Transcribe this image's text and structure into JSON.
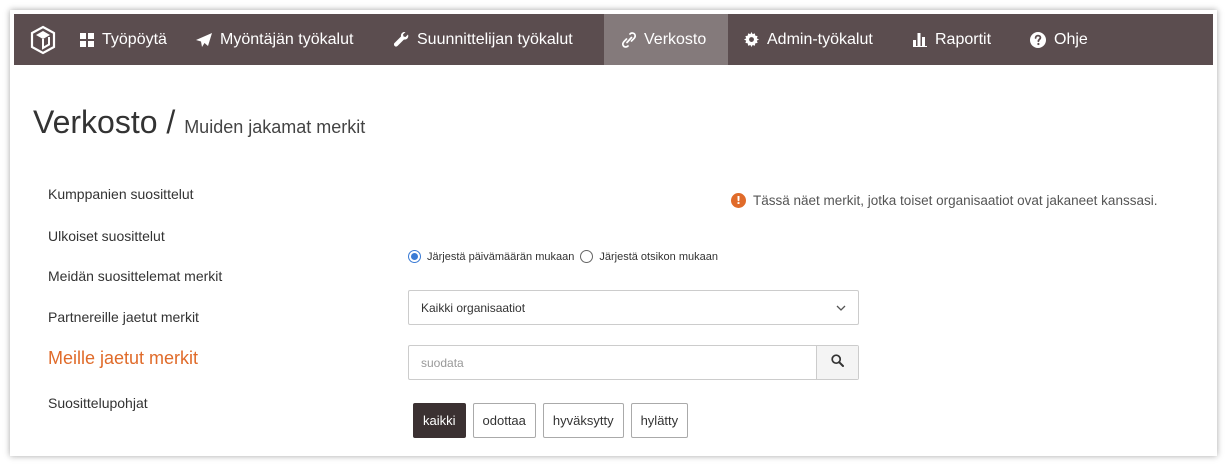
{
  "nav": {
    "logo_icon": "app-logo-icon",
    "items": [
      {
        "label": "Työpöytä",
        "icon": "dashboard-grid-icon",
        "active": false
      },
      {
        "label": "Myöntäjän työkalut",
        "icon": "paper-plane-icon",
        "active": false
      },
      {
        "label": "Suunnittelijan työkalut",
        "icon": "wrench-icon",
        "active": false
      },
      {
        "label": "Verkosto",
        "icon": "link-icon",
        "active": true
      },
      {
        "label": "Admin-työkalut",
        "icon": "gear-icon",
        "active": false
      },
      {
        "label": "Raportit",
        "icon": "bar-chart-icon",
        "active": false
      },
      {
        "label": "Ohje",
        "icon": "question-circle-icon",
        "active": false
      }
    ],
    "bg_color": "#5b4d4f",
    "active_color": "#847a7b"
  },
  "header": {
    "title": "Verkosto /",
    "subtitle": "Muiden jakamat merkit"
  },
  "sidebar": {
    "items": [
      {
        "label": "Kumppanien suosittelut",
        "active": false
      },
      {
        "label": "Ulkoiset suosittelut",
        "active": false
      },
      {
        "label": "Meidän suosittelemat merkit",
        "active": false
      },
      {
        "label": "Partnereille jaetut merkit",
        "active": false
      },
      {
        "label": "Meille jaetut merkit",
        "active": true
      },
      {
        "label": "Suosittelupohjat",
        "active": false
      }
    ],
    "active_color": "#e06b2a"
  },
  "info": {
    "icon": "info-icon",
    "text": "Tässä näet merkit, jotka toiset organisaatiot ovat jakaneet kanssasi."
  },
  "sort": {
    "options": [
      {
        "label": "Järjestä päivämäärän mukaan",
        "checked": true
      },
      {
        "label": "Järjestä otsikon mukaan",
        "checked": false
      }
    ]
  },
  "org_select": {
    "value": "Kaikki organisaatiot",
    "icon": "chevron-down-icon"
  },
  "search": {
    "placeholder": "suodata",
    "value": "",
    "icon": "search-icon"
  },
  "filters": [
    {
      "label": "kaikki",
      "active": true
    },
    {
      "label": "odottaa",
      "active": false
    },
    {
      "label": "hyväksytty",
      "active": false
    },
    {
      "label": "hylätty",
      "active": false
    }
  ]
}
